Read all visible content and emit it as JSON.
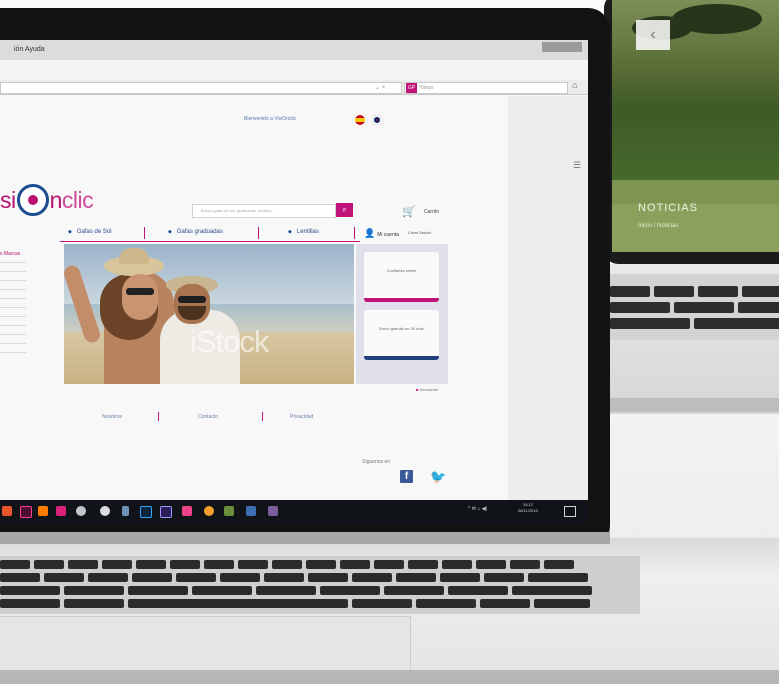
{
  "browser": {
    "menu": "ión   Ayuda",
    "search_engine_chip": "GP",
    "search_placeholder": "Yahoo",
    "url_controls": "⌄ × "
  },
  "site": {
    "welcome": "Bienvenido a VisiOnclic",
    "logo_prefix": "si",
    "logo_suffix": "n",
    "logo_clic": "clic",
    "search_placeholder": "Busca gafas de sol, graduadas, lentillas...",
    "cart_label": "Carrito",
    "nav": [
      "Gafas de Sol",
      "Gafas graduadas",
      "Lentillas"
    ],
    "account": "Mi cuenta",
    "account_2": "Crear Sesión",
    "sidebar_title": "s Marcas",
    "sidebar_items": [
      "",
      "",
      "",
      "",
      "",
      "",
      "",
      "",
      "",
      ""
    ],
    "watermark": "iStock",
    "promos": [
      {
        "text": "Confianza online",
        "color": "#c0147a"
      },
      {
        "text": "Envío gratuito en 30 días",
        "color": "#1f3f7d"
      }
    ],
    "newsletter": "Newsletter",
    "footer": [
      "Nosotros",
      "Contacto",
      "Privacidad"
    ],
    "follow": "Síguenos en"
  },
  "taskbar": {
    "tray": "^ ✉ ⌂ ◀)",
    "time": "15:12",
    "date": "08/11/2016"
  },
  "second_laptop": {
    "title": "NOTICIAS",
    "breadcrumb": "Inicio / Noticias",
    "back_arrow": "‹"
  },
  "colors": {
    "brand_magenta": "#c0147a",
    "brand_blue": "#1c4e8f",
    "taskbar": "#101318"
  }
}
